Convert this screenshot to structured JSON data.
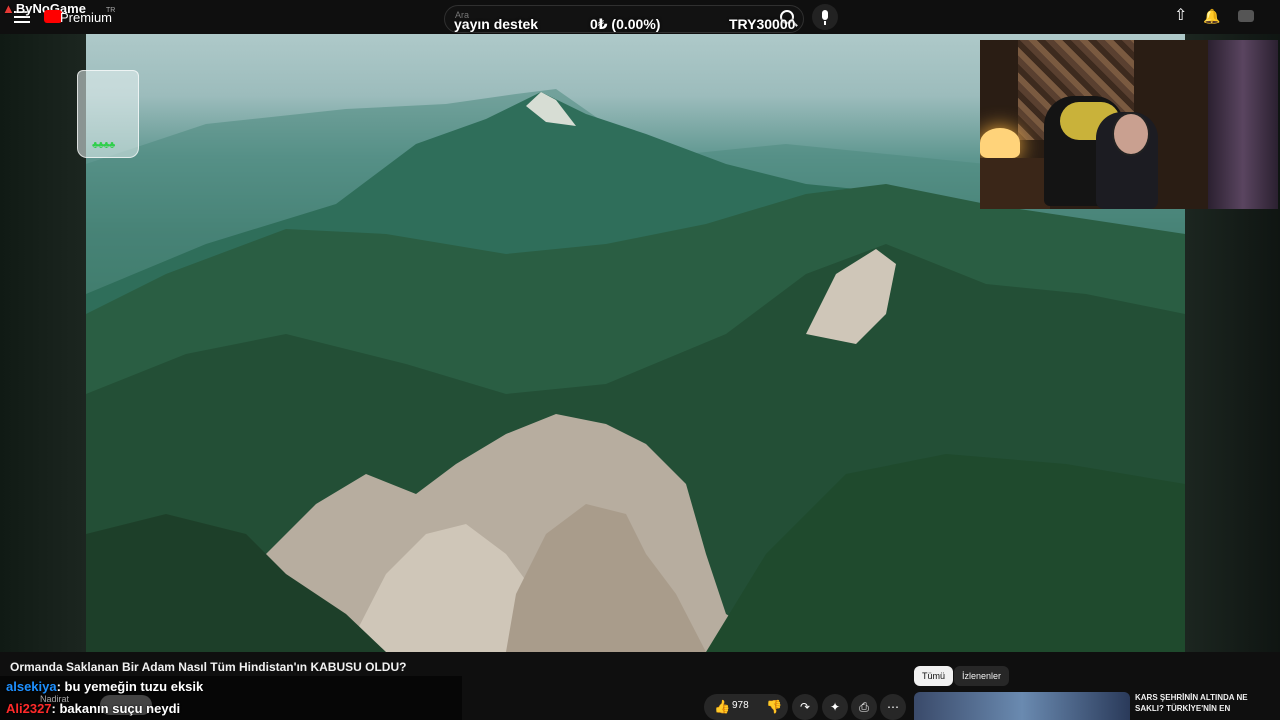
{
  "overlay": {
    "brand": "ByNoGame"
  },
  "header": {
    "logo_text": "Premium",
    "country_code": "TR",
    "search_placeholder": "Ara"
  },
  "donation_bar": {
    "label": "yayın destek",
    "progress_text": "0₺ (0.00%)",
    "goal": "TRY30000",
    "progress_fraction": 0
  },
  "icons": {
    "menu": "menu-icon",
    "search": "search-icon",
    "mic": "mic-icon",
    "upload": "upload-icon",
    "bell": "bell-icon"
  },
  "video": {
    "title": "Ormanda Saklanan Bir Adam Nasıl Tüm Hindistan'ın KABUSU OLDU?"
  },
  "chat": {
    "messages": [
      {
        "user": "alsekiya",
        "text": ": bu yemeğin tuzu eksik"
      },
      {
        "user": "Ali2327",
        "text": ": bakanın suçu neydi"
      }
    ],
    "channel_name": "Nadirat"
  },
  "actions": {
    "like_count": "978"
  },
  "recommendations": {
    "chips": [
      "Tümü",
      "İzlenenler"
    ],
    "first_title": "KARS ŞEHRİNİN ALTINDA NE SAKLI? TÜRKİYE'NİN EN"
  },
  "colors": {
    "chat_user_1": "#1e90ff",
    "chat_user_2": "#ff2a2a",
    "background": "#0f0f0f"
  }
}
